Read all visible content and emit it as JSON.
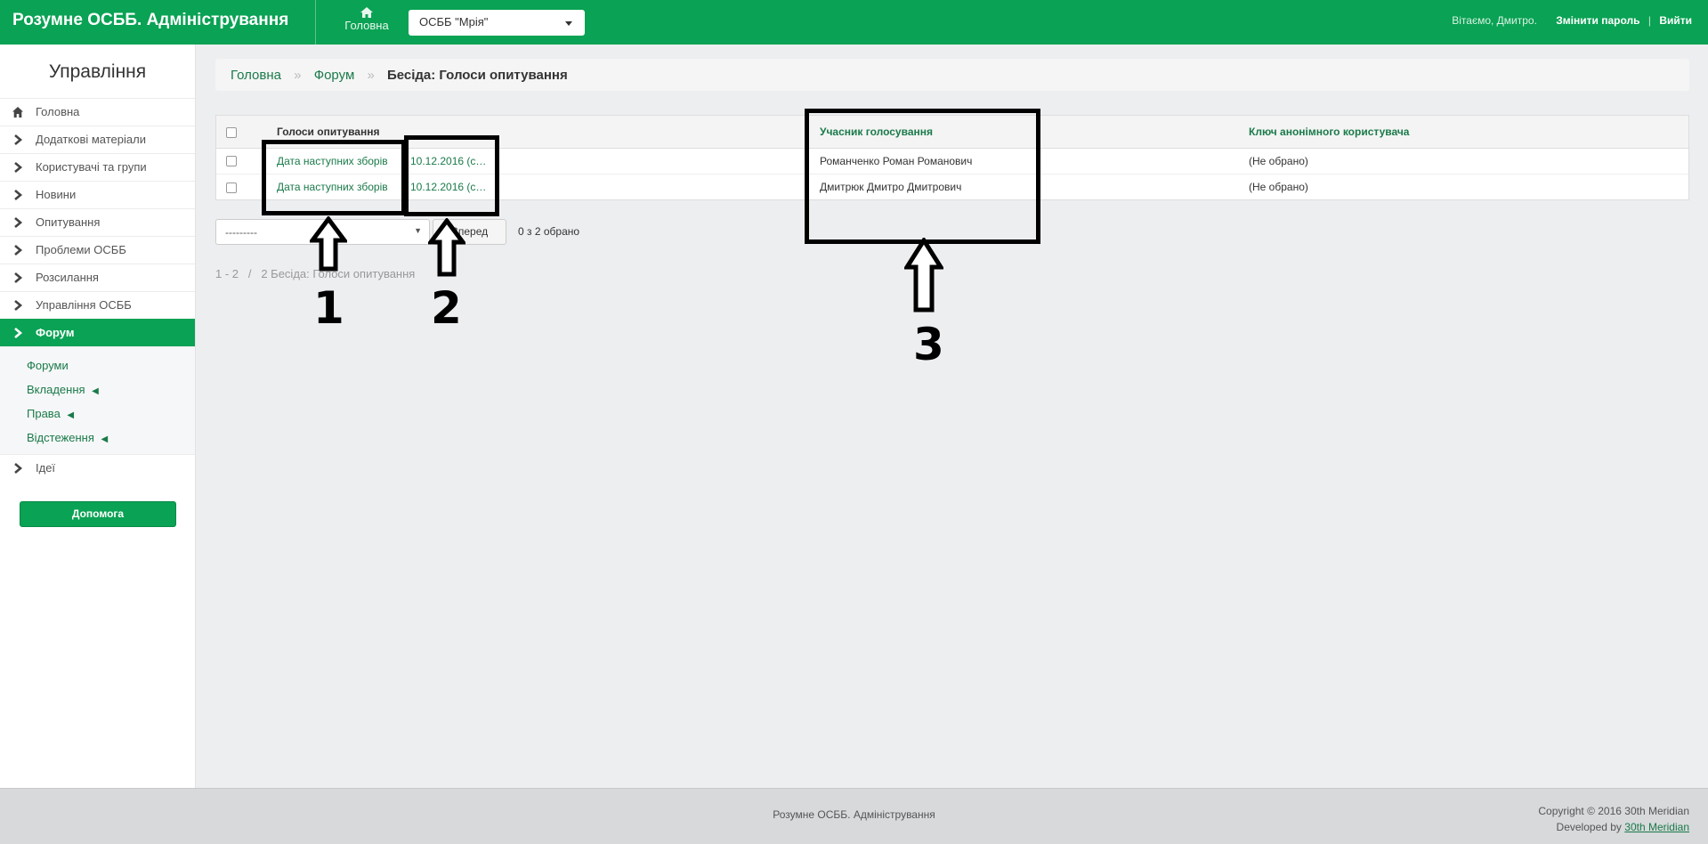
{
  "header": {
    "brand": "Розумне ОСББ. Адміністрування",
    "home_label": "Головна",
    "org_select": "ОСББ \"Мрія\"",
    "greeting": "Вітаємо, Дмитро.",
    "change_password": "Змінити пароль",
    "separator": "|",
    "logout": "Вийти",
    "accent_color": "#0aa254"
  },
  "sidebar": {
    "title": "Управління",
    "items": [
      {
        "label": "Головна",
        "icon": "home-icon"
      },
      {
        "label": "Додаткові матеріали",
        "icon": "chevron-right-icon"
      },
      {
        "label": "Користувачі та групи",
        "icon": "chevron-right-icon"
      },
      {
        "label": "Новини",
        "icon": "chevron-right-icon"
      },
      {
        "label": "Опитування",
        "icon": "chevron-right-icon"
      },
      {
        "label": "Проблеми ОСББ",
        "icon": "chevron-right-icon"
      },
      {
        "label": "Розсилання",
        "icon": "chevron-right-icon"
      },
      {
        "label": "Управління ОСББ",
        "icon": "chevron-right-icon"
      },
      {
        "label": "Форум",
        "icon": "chevron-right-icon",
        "active": true
      }
    ],
    "subitems": [
      {
        "label": "Форуми",
        "marker": ""
      },
      {
        "label": "Вкладення",
        "marker": "◀"
      },
      {
        "label": "Права",
        "marker": "◀"
      },
      {
        "label": "Відстеження",
        "marker": "◀"
      }
    ],
    "after_items": [
      {
        "label": "Ідеї",
        "icon": "chevron-right-icon"
      }
    ],
    "help_button": "Допомога"
  },
  "breadcrumb": {
    "home": "Головна",
    "forum": "Форум",
    "current": "Бесіда: Голоси опитування",
    "separator": "»"
  },
  "table": {
    "columns": [
      "Голоси опитування",
      "Учасник голосування",
      "Ключ анонімного користувача"
    ],
    "rows": [
      {
        "vote": "Дата наступних зборів",
        "date": "10.12.2016 (с…",
        "user": "Романченко Роман Романович",
        "key": "(Не обрано)"
      },
      {
        "vote": "Дата наступних зборів",
        "date": "10.12.2016 (с…",
        "user": "Дмитрюк Дмитро Дмитрович",
        "key": "(Не обрано)"
      }
    ]
  },
  "actions": {
    "select_value": "---------",
    "go_button": "Вперед",
    "selected_count": "0 з 2 обрано"
  },
  "paginator": {
    "range": "1 - 2",
    "separator": "/",
    "summary": "2 Бесіда: Голоси опитування"
  },
  "annotations": {
    "labels": [
      "1",
      "2",
      "3"
    ]
  },
  "footer": {
    "center": "Розумне ОСББ. Адміністрування",
    "copyright": "Copyright © 2016 30th Meridian",
    "developed_prefix": "Developed by",
    "developer": "30th Meridian"
  }
}
